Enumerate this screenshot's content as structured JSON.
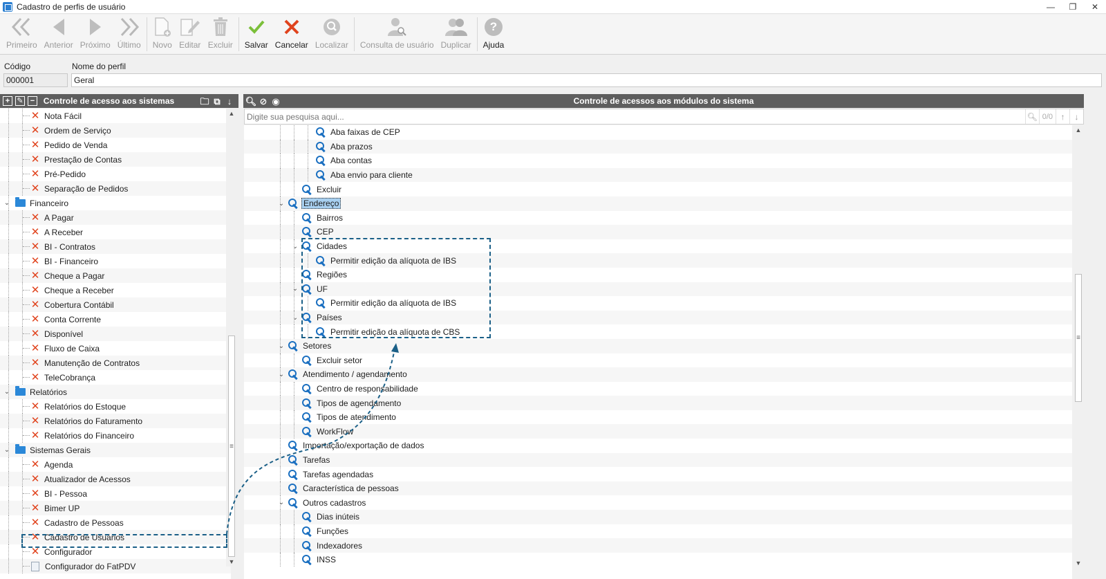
{
  "window": {
    "title": "Cadastro de perfis de usuário",
    "minimize": "—",
    "restore": "❐",
    "close": "✕"
  },
  "toolbar": {
    "primeiro": "Primeiro",
    "anterior": "Anterior",
    "proximo": "Próximo",
    "ultimo": "Último",
    "novo": "Novo",
    "editar": "Editar",
    "excluir": "Excluir",
    "salvar": "Salvar",
    "cancelar": "Cancelar",
    "localizar": "Localizar",
    "consulta": "Consulta de usuário",
    "duplicar": "Duplicar",
    "ajuda": "Ajuda"
  },
  "fields": {
    "codigo_label": "Código",
    "codigo_value": "000001",
    "nome_label": "Nome do perfil",
    "nome_value": "Geral"
  },
  "left_panel": {
    "title": "Controle de acesso aos sistemas",
    "items": [
      {
        "label": "Nota Fácil",
        "level": 2,
        "type": "denied"
      },
      {
        "label": "Ordem de Serviço",
        "level": 2,
        "type": "denied"
      },
      {
        "label": "Pedido de Venda",
        "level": 2,
        "type": "denied"
      },
      {
        "label": "Prestação de Contas",
        "level": 2,
        "type": "denied"
      },
      {
        "label": "Pré-Pedido",
        "level": 2,
        "type": "denied"
      },
      {
        "label": "Separação de Pedidos",
        "level": 2,
        "type": "denied"
      },
      {
        "label": "Financeiro",
        "level": 1,
        "type": "folder"
      },
      {
        "label": "A Pagar",
        "level": 2,
        "type": "denied"
      },
      {
        "label": "A Receber",
        "level": 2,
        "type": "denied"
      },
      {
        "label": "BI - Contratos",
        "level": 2,
        "type": "denied"
      },
      {
        "label": "BI - Financeiro",
        "level": 2,
        "type": "denied"
      },
      {
        "label": "Cheque a Pagar",
        "level": 2,
        "type": "denied"
      },
      {
        "label": "Cheque a Receber",
        "level": 2,
        "type": "denied"
      },
      {
        "label": "Cobertura Contábil",
        "level": 2,
        "type": "denied"
      },
      {
        "label": "Conta Corrente",
        "level": 2,
        "type": "denied"
      },
      {
        "label": "Disponível",
        "level": 2,
        "type": "denied"
      },
      {
        "label": "Fluxo de Caixa",
        "level": 2,
        "type": "denied"
      },
      {
        "label": "Manutenção de Contratos",
        "level": 2,
        "type": "denied"
      },
      {
        "label": "TeleCobrança",
        "level": 2,
        "type": "denied"
      },
      {
        "label": "Relatórios",
        "level": 1,
        "type": "folder"
      },
      {
        "label": "Relatórios do Estoque",
        "level": 2,
        "type": "denied"
      },
      {
        "label": "Relatórios do Faturamento",
        "level": 2,
        "type": "denied"
      },
      {
        "label": "Relatórios do Financeiro",
        "level": 2,
        "type": "denied"
      },
      {
        "label": "Sistemas Gerais",
        "level": 1,
        "type": "folder"
      },
      {
        "label": "Agenda",
        "level": 2,
        "type": "denied"
      },
      {
        "label": "Atualizador de Acessos",
        "level": 2,
        "type": "denied"
      },
      {
        "label": "BI - Pessoa",
        "level": 2,
        "type": "denied"
      },
      {
        "label": "Bimer UP",
        "level": 2,
        "type": "denied"
      },
      {
        "label": "Cadastro de Pessoas",
        "level": 2,
        "type": "denied"
      },
      {
        "label": "Cadastro de Usuários",
        "level": 2,
        "type": "denied"
      },
      {
        "label": "Configurador",
        "level": 2,
        "type": "denied"
      },
      {
        "label": "Configurador do FatPDV",
        "level": 2,
        "type": "doc"
      }
    ]
  },
  "right_panel": {
    "title": "Controle de acessos aos módulos do sistema",
    "search_placeholder": "Digite sua pesquisa aqui...",
    "search_count": "0/0",
    "items": [
      {
        "label": "Aba faixas de CEP",
        "level": 3,
        "expander": false
      },
      {
        "label": "Aba prazos",
        "level": 3,
        "expander": false
      },
      {
        "label": "Aba contas",
        "level": 3,
        "expander": false
      },
      {
        "label": "Aba envio para cliente",
        "level": 3,
        "expander": false
      },
      {
        "label": "Excluir",
        "level": 2,
        "expander": false
      },
      {
        "label": "Endereço",
        "level": 1,
        "expander": true,
        "selected": true
      },
      {
        "label": "Bairros",
        "level": 2,
        "expander": false
      },
      {
        "label": "CEP",
        "level": 2,
        "expander": false
      },
      {
        "label": "Cidades",
        "level": 2,
        "expander": true
      },
      {
        "label": "Permitir edição da alíquota de IBS",
        "level": 3,
        "expander": false
      },
      {
        "label": "Regiões",
        "level": 2,
        "expander": false
      },
      {
        "label": "UF",
        "level": 2,
        "expander": true
      },
      {
        "label": "Permitir edição da alíquota de IBS",
        "level": 3,
        "expander": false
      },
      {
        "label": "Países",
        "level": 2,
        "expander": true
      },
      {
        "label": "Permitir edição da alíquota de CBS",
        "level": 3,
        "expander": false
      },
      {
        "label": "Setores",
        "level": 1,
        "expander": true
      },
      {
        "label": "Excluir setor",
        "level": 2,
        "expander": false
      },
      {
        "label": "Atendimento / agendamento",
        "level": 1,
        "expander": true
      },
      {
        "label": "Centro de responsabilidade",
        "level": 2,
        "expander": false
      },
      {
        "label": "Tipos de agendamento",
        "level": 2,
        "expander": false
      },
      {
        "label": "Tipos de atendimento",
        "level": 2,
        "expander": false
      },
      {
        "label": "WorkFlow",
        "level": 2,
        "expander": false
      },
      {
        "label": "Importação/exportação de dados",
        "level": 1,
        "expander": false
      },
      {
        "label": "Tarefas",
        "level": 1,
        "expander": false
      },
      {
        "label": "Tarefas agendadas",
        "level": 1,
        "expander": false
      },
      {
        "label": "Característica de pessoas",
        "level": 1,
        "expander": false
      },
      {
        "label": "Outros cadastros",
        "level": 1,
        "expander": true
      },
      {
        "label": "Dias inúteis",
        "level": 2,
        "expander": false
      },
      {
        "label": "Funções",
        "level": 2,
        "expander": false
      },
      {
        "label": "Indexadores",
        "level": 2,
        "expander": false
      },
      {
        "label": "INSS",
        "level": 2,
        "expander": false
      }
    ]
  },
  "colors": {
    "accent": "#1a6fc0",
    "denied": "#e0431d",
    "salvar": "#7bbf3a",
    "cancelar": "#e0431d",
    "annotation": "#1a5f87"
  }
}
